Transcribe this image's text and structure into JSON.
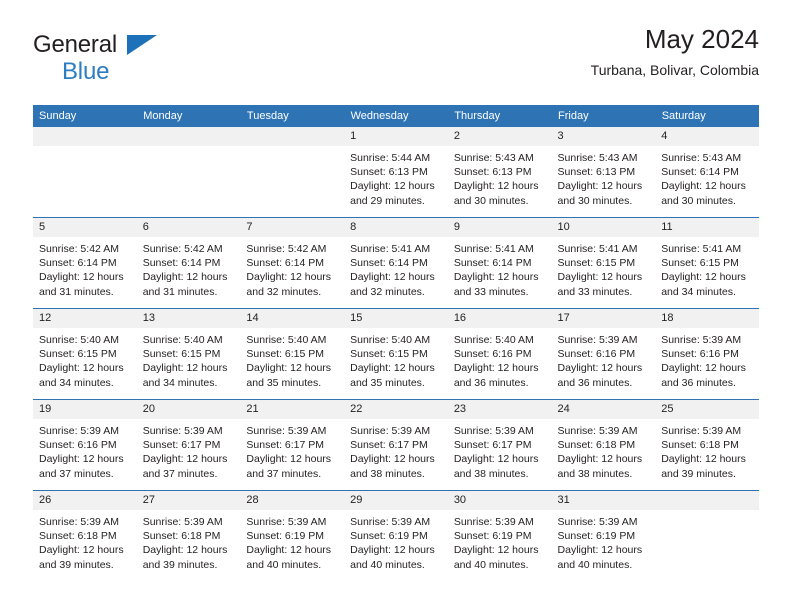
{
  "brand": {
    "name_top": "General",
    "name_bottom": "Blue",
    "accent_color": "#2d7dc1",
    "triangle_color": "#1d71b8"
  },
  "header": {
    "title": "May 2024",
    "subtitle": "Turbana, Bolivar, Colombia"
  },
  "calendar": {
    "header_bg": "#2e74b5",
    "daynum_bg": "#f1f1f1",
    "weekday_headers": [
      "Sunday",
      "Monday",
      "Tuesday",
      "Wednesday",
      "Thursday",
      "Friday",
      "Saturday"
    ],
    "labels": {
      "sunrise": "Sunrise:",
      "sunset": "Sunset:",
      "daylight": "Daylight:"
    },
    "weeks": [
      [
        {
          "day": "",
          "empty": true
        },
        {
          "day": "",
          "empty": true
        },
        {
          "day": "",
          "empty": true
        },
        {
          "day": "1",
          "sunrise": "Sunrise: 5:44 AM",
          "sunset": "Sunset: 6:13 PM",
          "daylight_1": "Daylight: 12 hours",
          "daylight_2": "and 29 minutes."
        },
        {
          "day": "2",
          "sunrise": "Sunrise: 5:43 AM",
          "sunset": "Sunset: 6:13 PM",
          "daylight_1": "Daylight: 12 hours",
          "daylight_2": "and 30 minutes."
        },
        {
          "day": "3",
          "sunrise": "Sunrise: 5:43 AM",
          "sunset": "Sunset: 6:13 PM",
          "daylight_1": "Daylight: 12 hours",
          "daylight_2": "and 30 minutes."
        },
        {
          "day": "4",
          "sunrise": "Sunrise: 5:43 AM",
          "sunset": "Sunset: 6:14 PM",
          "daylight_1": "Daylight: 12 hours",
          "daylight_2": "and 30 minutes."
        }
      ],
      [
        {
          "day": "5",
          "sunrise": "Sunrise: 5:42 AM",
          "sunset": "Sunset: 6:14 PM",
          "daylight_1": "Daylight: 12 hours",
          "daylight_2": "and 31 minutes."
        },
        {
          "day": "6",
          "sunrise": "Sunrise: 5:42 AM",
          "sunset": "Sunset: 6:14 PM",
          "daylight_1": "Daylight: 12 hours",
          "daylight_2": "and 31 minutes."
        },
        {
          "day": "7",
          "sunrise": "Sunrise: 5:42 AM",
          "sunset": "Sunset: 6:14 PM",
          "daylight_1": "Daylight: 12 hours",
          "daylight_2": "and 32 minutes."
        },
        {
          "day": "8",
          "sunrise": "Sunrise: 5:41 AM",
          "sunset": "Sunset: 6:14 PM",
          "daylight_1": "Daylight: 12 hours",
          "daylight_2": "and 32 minutes."
        },
        {
          "day": "9",
          "sunrise": "Sunrise: 5:41 AM",
          "sunset": "Sunset: 6:14 PM",
          "daylight_1": "Daylight: 12 hours",
          "daylight_2": "and 33 minutes."
        },
        {
          "day": "10",
          "sunrise": "Sunrise: 5:41 AM",
          "sunset": "Sunset: 6:15 PM",
          "daylight_1": "Daylight: 12 hours",
          "daylight_2": "and 33 minutes."
        },
        {
          "day": "11",
          "sunrise": "Sunrise: 5:41 AM",
          "sunset": "Sunset: 6:15 PM",
          "daylight_1": "Daylight: 12 hours",
          "daylight_2": "and 34 minutes."
        }
      ],
      [
        {
          "day": "12",
          "sunrise": "Sunrise: 5:40 AM",
          "sunset": "Sunset: 6:15 PM",
          "daylight_1": "Daylight: 12 hours",
          "daylight_2": "and 34 minutes."
        },
        {
          "day": "13",
          "sunrise": "Sunrise: 5:40 AM",
          "sunset": "Sunset: 6:15 PM",
          "daylight_1": "Daylight: 12 hours",
          "daylight_2": "and 34 minutes."
        },
        {
          "day": "14",
          "sunrise": "Sunrise: 5:40 AM",
          "sunset": "Sunset: 6:15 PM",
          "daylight_1": "Daylight: 12 hours",
          "daylight_2": "and 35 minutes."
        },
        {
          "day": "15",
          "sunrise": "Sunrise: 5:40 AM",
          "sunset": "Sunset: 6:15 PM",
          "daylight_1": "Daylight: 12 hours",
          "daylight_2": "and 35 minutes."
        },
        {
          "day": "16",
          "sunrise": "Sunrise: 5:40 AM",
          "sunset": "Sunset: 6:16 PM",
          "daylight_1": "Daylight: 12 hours",
          "daylight_2": "and 36 minutes."
        },
        {
          "day": "17",
          "sunrise": "Sunrise: 5:39 AM",
          "sunset": "Sunset: 6:16 PM",
          "daylight_1": "Daylight: 12 hours",
          "daylight_2": "and 36 minutes."
        },
        {
          "day": "18",
          "sunrise": "Sunrise: 5:39 AM",
          "sunset": "Sunset: 6:16 PM",
          "daylight_1": "Daylight: 12 hours",
          "daylight_2": "and 36 minutes."
        }
      ],
      [
        {
          "day": "19",
          "sunrise": "Sunrise: 5:39 AM",
          "sunset": "Sunset: 6:16 PM",
          "daylight_1": "Daylight: 12 hours",
          "daylight_2": "and 37 minutes."
        },
        {
          "day": "20",
          "sunrise": "Sunrise: 5:39 AM",
          "sunset": "Sunset: 6:17 PM",
          "daylight_1": "Daylight: 12 hours",
          "daylight_2": "and 37 minutes."
        },
        {
          "day": "21",
          "sunrise": "Sunrise: 5:39 AM",
          "sunset": "Sunset: 6:17 PM",
          "daylight_1": "Daylight: 12 hours",
          "daylight_2": "and 37 minutes."
        },
        {
          "day": "22",
          "sunrise": "Sunrise: 5:39 AM",
          "sunset": "Sunset: 6:17 PM",
          "daylight_1": "Daylight: 12 hours",
          "daylight_2": "and 38 minutes."
        },
        {
          "day": "23",
          "sunrise": "Sunrise: 5:39 AM",
          "sunset": "Sunset: 6:17 PM",
          "daylight_1": "Daylight: 12 hours",
          "daylight_2": "and 38 minutes."
        },
        {
          "day": "24",
          "sunrise": "Sunrise: 5:39 AM",
          "sunset": "Sunset: 6:18 PM",
          "daylight_1": "Daylight: 12 hours",
          "daylight_2": "and 38 minutes."
        },
        {
          "day": "25",
          "sunrise": "Sunrise: 5:39 AM",
          "sunset": "Sunset: 6:18 PM",
          "daylight_1": "Daylight: 12 hours",
          "daylight_2": "and 39 minutes."
        }
      ],
      [
        {
          "day": "26",
          "sunrise": "Sunrise: 5:39 AM",
          "sunset": "Sunset: 6:18 PM",
          "daylight_1": "Daylight: 12 hours",
          "daylight_2": "and 39 minutes."
        },
        {
          "day": "27",
          "sunrise": "Sunrise: 5:39 AM",
          "sunset": "Sunset: 6:18 PM",
          "daylight_1": "Daylight: 12 hours",
          "daylight_2": "and 39 minutes."
        },
        {
          "day": "28",
          "sunrise": "Sunrise: 5:39 AM",
          "sunset": "Sunset: 6:19 PM",
          "daylight_1": "Daylight: 12 hours",
          "daylight_2": "and 40 minutes."
        },
        {
          "day": "29",
          "sunrise": "Sunrise: 5:39 AM",
          "sunset": "Sunset: 6:19 PM",
          "daylight_1": "Daylight: 12 hours",
          "daylight_2": "and 40 minutes."
        },
        {
          "day": "30",
          "sunrise": "Sunrise: 5:39 AM",
          "sunset": "Sunset: 6:19 PM",
          "daylight_1": "Daylight: 12 hours",
          "daylight_2": "and 40 minutes."
        },
        {
          "day": "31",
          "sunrise": "Sunrise: 5:39 AM",
          "sunset": "Sunset: 6:19 PM",
          "daylight_1": "Daylight: 12 hours",
          "daylight_2": "and 40 minutes."
        },
        {
          "day": "",
          "empty": true
        }
      ]
    ]
  }
}
